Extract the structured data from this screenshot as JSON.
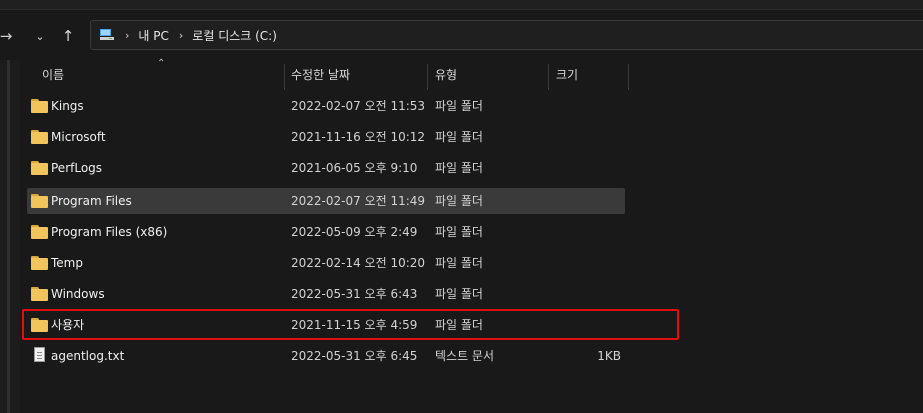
{
  "address": {
    "segments": [
      "내 PC",
      "로컬 디스크 (C:)"
    ]
  },
  "columns": {
    "name": "이름",
    "date": "수정한 날짜",
    "type": "유형",
    "size": "크기"
  },
  "files": [
    {
      "name": "Kings",
      "date": "2022-02-07 오전 11:53",
      "type": "파일 폴더",
      "size": "",
      "icon": "folder-icon"
    },
    {
      "name": "Microsoft",
      "date": "2021-11-16 오전 10:12",
      "type": "파일 폴더",
      "size": "",
      "icon": "folder-icon"
    },
    {
      "name": "PerfLogs",
      "date": "2021-06-05 오후 9:10",
      "type": "파일 폴더",
      "size": "",
      "icon": "folder-icon"
    },
    {
      "name": "Program Files",
      "date": "2022-02-07 오전 11:49",
      "type": "파일 폴더",
      "size": "",
      "icon": "folder-icon",
      "selected": true
    },
    {
      "name": "Program Files (x86)",
      "date": "2022-05-09 오후 2:49",
      "type": "파일 폴더",
      "size": "",
      "icon": "folder-icon"
    },
    {
      "name": "Temp",
      "date": "2022-02-14 오전 10:20",
      "type": "파일 폴더",
      "size": "",
      "icon": "folder-icon"
    },
    {
      "name": "Windows",
      "date": "2022-05-31 오후 6:43",
      "type": "파일 폴더",
      "size": "",
      "icon": "folder-icon"
    },
    {
      "name": "사용자",
      "date": "2021-11-15 오후 4:59",
      "type": "파일 폴더",
      "size": "",
      "icon": "folder-icon"
    },
    {
      "name": "agentlog.txt",
      "date": "2022-05-31 오후 6:45",
      "type": "텍스트 문서",
      "size": "1KB",
      "icon": "text-file-icon"
    }
  ],
  "colors": {
    "background": "#191919",
    "selection": "#3a3a3a",
    "highlight_border": "#e01010",
    "folder": "#f2c55c"
  }
}
